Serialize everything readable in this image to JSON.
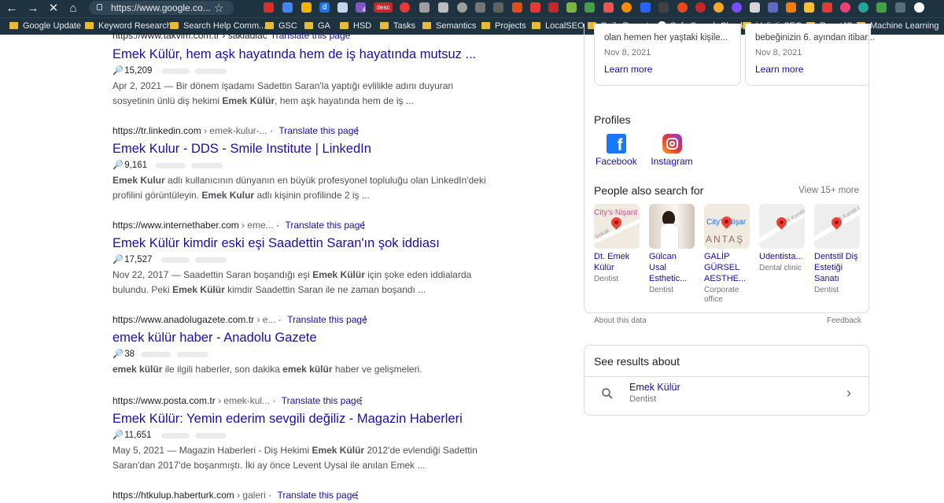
{
  "browser": {
    "url": "https://www.google.co...",
    "nav_icons": [
      "back-icon",
      "forward-icon",
      "close-icon",
      "home-icon"
    ],
    "bookmarks": [
      "Google Update",
      "Keyword Research",
      "Search Help Comm...",
      "GSC",
      "GA",
      "HSD",
      "Tasks",
      "Semantics",
      "Projects",
      "LocalSEO",
      "Daily Reports",
      "Safe Search Check",
      "HolisticSEO",
      "ReactJS",
      "Machine Learning"
    ],
    "ext_badges": {
      "four": "4",
      "desc": "desc"
    }
  },
  "results": [
    {
      "cite": "https://www.takvim.com.tr › sakladiac",
      "translate": "Translate this page",
      "title": "Emek Külür, hem aşk hayatında hem de iş hayatında mutsuz ...",
      "count": "15,209",
      "date": "Apr 2, 2021",
      "snip_a": "Bir dönem işadamı Sadettin Saran'la yaptığı evlilikle adını duyuran sosyetinin ünlü diş hekimi",
      "snip_b": "Emek Külür",
      "snip_c": ", hem aşk hayatında hem de iş ..."
    },
    {
      "cite": "https://tr.linkedin.com",
      "crumb": "› emek-kulur-...",
      "translate": "Translate this page",
      "title": "Emek Kulur - DDS - Smile Institute | LinkedIn",
      "count": "9,161",
      "snip_a": "Emek Kulur",
      "snip_b": "adlı kullanıcının dünyanın en büyük profesyonel topluluğu olan LinkedIn'deki profilini görüntüleyin.",
      "snip_c": "Emek Kulur",
      "snip_d": "adlı kişinin profilinde 2 iş ..."
    },
    {
      "cite": "https://www.internethaber.com",
      "crumb": "› eme...",
      "translate": "Translate this page",
      "title": "Emek Külür kimdir eski eşi Saadettin Saran'ın şok iddiası",
      "count": "17,527",
      "date": "Nov 22, 2017",
      "snip_a": "Saadettin Saran boşandığı eşi",
      "snip_b": "Emek Külür",
      "snip_c": "için şoke eden iddialarda bulundu. Peki",
      "snip_d": "Emek Külür",
      "snip_e": "kimdir Saadettin Saran ile ne zaman boşandı ..."
    },
    {
      "cite": "https://www.anadolugazete.com.tr",
      "crumb": "› e...",
      "translate": "Translate this page",
      "title": "emek külür haber - Anadolu Gazete",
      "count": "38",
      "snip_a": "emek külür",
      "snip_b": "ile ilgili haberler, son dakika",
      "snip_c": "emek külür",
      "snip_d": "haber ve gelişmeleri."
    },
    {
      "cite": "https://www.posta.com.tr",
      "crumb": "› emek-kul...",
      "translate": "Translate this page",
      "title": "Emek Külür: Yemin ederim sevgili değiliz - Magazin Haberleri",
      "count": "11,651",
      "date": "May 5, 2021",
      "snip_a": "Magazin Haberleri - Diş Hekimi",
      "snip_b": "Emek Külür",
      "snip_c": "2012'de evlendiği Sadettin Saran'dan 2017'de boşanmıştı. İki ay önce Levent Uysal ile anılan Emek ..."
    },
    {
      "cite": "https://htkulup.haberturk.com",
      "crumb": "› galeri",
      "translate": "Translate this page"
    }
  ],
  "panel": {
    "news": [
      {
        "snippet": "olan hemen her yaştaki kişile...",
        "date": "Nov 8, 2021",
        "link": "Learn more"
      },
      {
        "snippet": "bebeğinizin 6. ayından itibar...",
        "date": "Nov 8, 2021",
        "link": "Learn more"
      }
    ],
    "profiles_heading": "Profiles",
    "profiles": [
      {
        "label": "Facebook",
        "letter": "f",
        "color": "#1877f2"
      },
      {
        "label": "Instagram",
        "color": "#c13584"
      }
    ],
    "pasf_heading": "People also search for",
    "view_more": "View 15+ more",
    "pasf": [
      {
        "line1": "Dt. Emek",
        "line2": "Külür",
        "type": "Dentist",
        "map_text": "City's Nişant",
        "street": "Sokak"
      },
      {
        "line1": "Gülcan",
        "line2": "Usal",
        "line3": "Esthetic...",
        "type": "Dentist"
      },
      {
        "line1": "GALİP",
        "line2": "GÜRSEL",
        "line3": "AESTHE...",
        "type": "Corporate",
        "type2": "office",
        "map_text": "City's Nişar",
        "map_text2": "ANTAŞ"
      },
      {
        "line1": "Udentista...",
        "type": "Dental clinic",
        "street": "Ali Kandil Cd."
      },
      {
        "line1": "Dentstil Diş",
        "line2": "Estetiği",
        "line3": "Sanatı",
        "type": "Dentist",
        "street": "Ali Kandil Cd."
      }
    ],
    "about": "About this data",
    "feedback": "Feedback",
    "see_about_heading": "See results about",
    "entity_name": "Emek Külür",
    "entity_type": "Dentist"
  }
}
